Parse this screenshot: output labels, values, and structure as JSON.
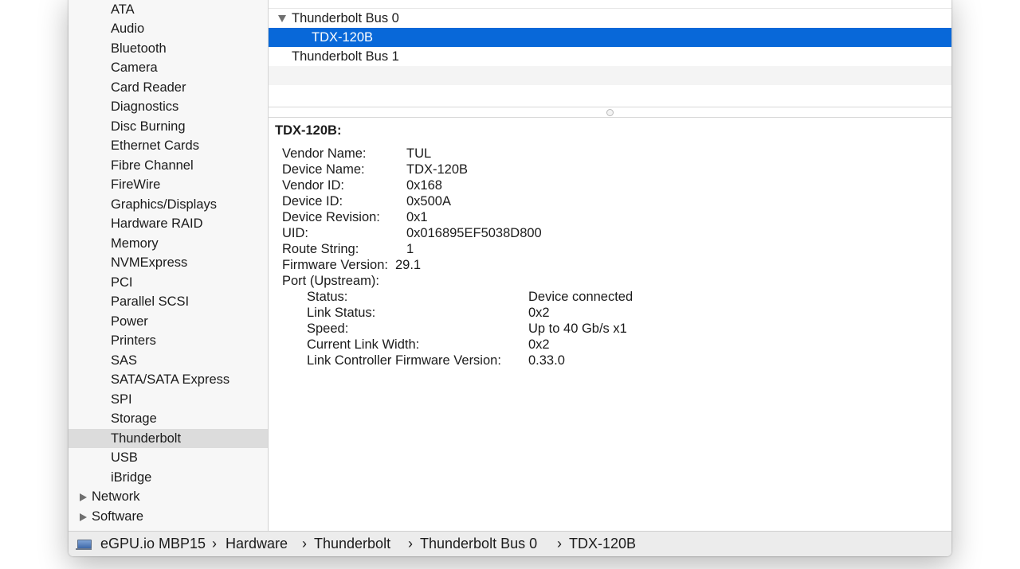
{
  "sidebar": {
    "items": [
      {
        "label": "ATA"
      },
      {
        "label": "Audio"
      },
      {
        "label": "Bluetooth"
      },
      {
        "label": "Camera"
      },
      {
        "label": "Card Reader"
      },
      {
        "label": "Diagnostics"
      },
      {
        "label": "Disc Burning"
      },
      {
        "label": "Ethernet Cards"
      },
      {
        "label": "Fibre Channel"
      },
      {
        "label": "FireWire"
      },
      {
        "label": "Graphics/Displays"
      },
      {
        "label": "Hardware RAID"
      },
      {
        "label": "Memory"
      },
      {
        "label": "NVMExpress"
      },
      {
        "label": "PCI"
      },
      {
        "label": "Parallel SCSI"
      },
      {
        "label": "Power"
      },
      {
        "label": "Printers"
      },
      {
        "label": "SAS"
      },
      {
        "label": "SATA/SATA Express"
      },
      {
        "label": "SPI"
      },
      {
        "label": "Storage"
      },
      {
        "label": "Thunderbolt",
        "selected": true
      },
      {
        "label": "USB"
      },
      {
        "label": "iBridge"
      }
    ],
    "groups": [
      {
        "label": "Network",
        "expanded": false
      },
      {
        "label": "Software",
        "expanded": false
      }
    ]
  },
  "tree": {
    "rows": [
      {
        "label": "Thunderbolt Bus 0",
        "expanded": true
      },
      {
        "label": "TDX-120B",
        "selected": true
      },
      {
        "label": "Thunderbolt Bus 1"
      }
    ]
  },
  "detail": {
    "title": "TDX-120B:",
    "props": [
      {
        "label": "Vendor Name:",
        "value": "TUL"
      },
      {
        "label": "Device Name:",
        "value": "TDX-120B"
      },
      {
        "label": "Vendor ID:",
        "value": "0x168"
      },
      {
        "label": "Device ID:",
        "value": "0x500A"
      },
      {
        "label": "Device Revision:",
        "value": "0x1"
      },
      {
        "label": "UID:",
        "value": "0x016895EF5038D800"
      },
      {
        "label": "Route String:",
        "value": "1"
      },
      {
        "label": "Firmware Version:",
        "value": "29.1"
      }
    ],
    "port": {
      "label": "Port (Upstream):",
      "props": [
        {
          "label": "Status:",
          "value": "Device connected"
        },
        {
          "label": "Link Status:",
          "value": "0x2"
        },
        {
          "label": "Speed:",
          "value": "Up to 40 Gb/s x1"
        },
        {
          "label": "Current Link Width:",
          "value": "0x2"
        },
        {
          "label": "Link Controller Firmware Version:",
          "value": "0.33.0"
        }
      ]
    }
  },
  "statusbar": {
    "icon": "computer-icon",
    "crumbs": [
      "eGPU.io MBP15",
      "Hardware",
      "Thunderbolt",
      "Thunderbolt Bus 0",
      "TDX-120B"
    ],
    "separator": "›"
  },
  "colors": {
    "selection": "#0868d9",
    "sidebar_selected": "#dcdcdc"
  }
}
